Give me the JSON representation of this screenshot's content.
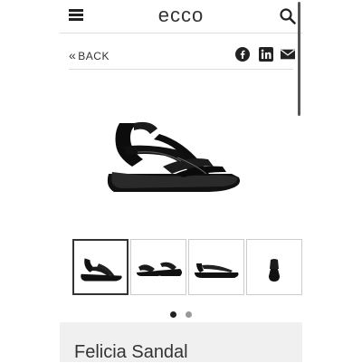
{
  "header": {
    "logo_text": "ecco",
    "menu_icon": "hamburger-menu-icon",
    "search_icon": "search-icon"
  },
  "subnav": {
    "back_label": "BACK",
    "share": [
      {
        "name": "facebook-icon",
        "label": "Facebook"
      },
      {
        "name": "linkedin-icon",
        "label": "LinkedIn"
      },
      {
        "name": "email-icon",
        "label": "Email"
      }
    ]
  },
  "gallery": {
    "thumbnail_count": 4,
    "active_thumbnail": 0,
    "pagination_dots": 2,
    "active_dot": 0
  },
  "product": {
    "name": "Felicia Sandal"
  },
  "colors": {
    "text": "#222222",
    "panel": "#f0f0f0",
    "divider": "#dddddd"
  }
}
